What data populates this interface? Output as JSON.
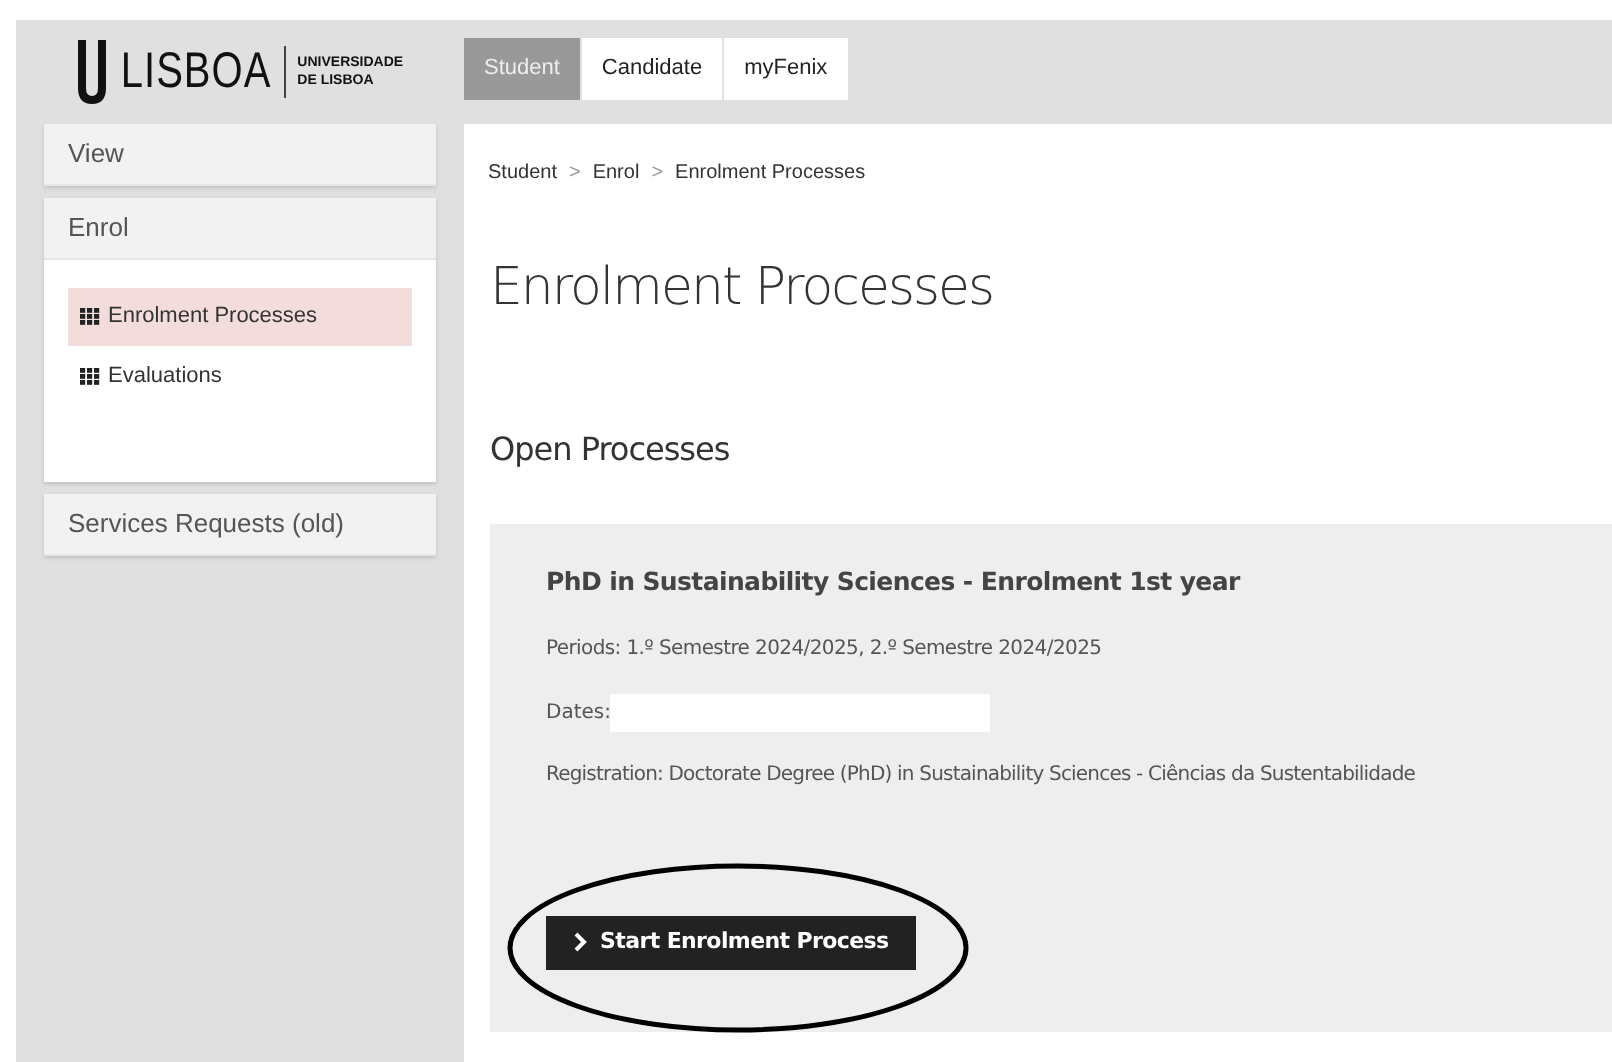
{
  "logo": {
    "wordmark": "LISBOA",
    "subtitle_1": "UNIVERSIDADE",
    "subtitle_2": "DE LISBOA"
  },
  "tabs": [
    {
      "label": "Student",
      "selected": true
    },
    {
      "label": "Candidate",
      "selected": false
    },
    {
      "label": "myFenix",
      "selected": false
    }
  ],
  "sidebar": [
    {
      "title": "View"
    },
    {
      "title": "Enrol",
      "items": [
        {
          "label": "Enrolment Processes",
          "selected": true
        },
        {
          "label": "Evaluations",
          "selected": false
        }
      ]
    },
    {
      "title": "Services Requests (old)"
    }
  ],
  "breadcrumb": [
    "Student",
    "Enrol",
    "Enrolment Processes"
  ],
  "breadcrumb_separator": ">",
  "page_title": "Enrolment Processes",
  "section_title": "Open Processes",
  "process": {
    "title": "PhD in Sustainability Sciences - Enrolment 1st year",
    "periods": "Periods: 1.º Semestre 2024/2025, 2.º Semestre 2024/2025",
    "dates_label": "Dates:",
    "dates_redacted": true,
    "registration": "Registration: Doctorate Degree (PhD) in Sustainability Sciences - Ciências da Sustentabilidade",
    "button": "Start Enrolment Process",
    "button_circled": true
  }
}
